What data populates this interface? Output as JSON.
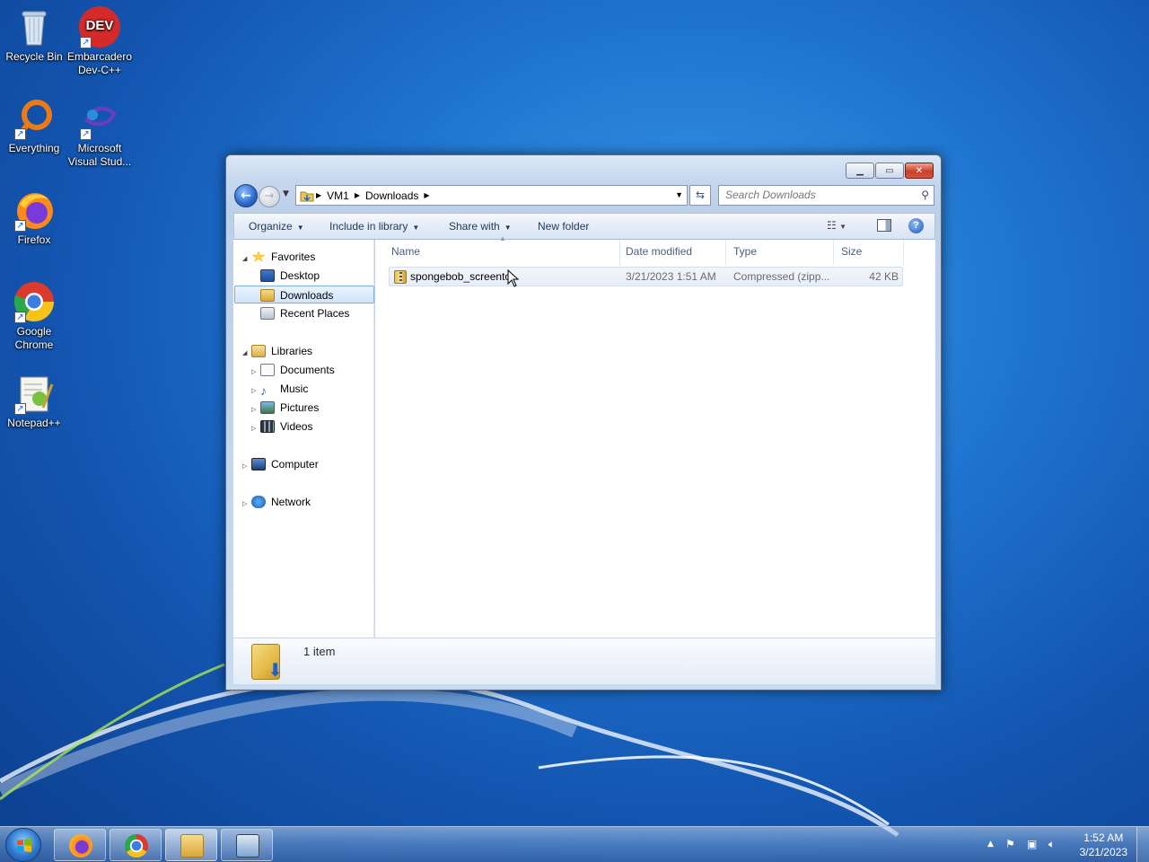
{
  "desktop": {
    "icons": [
      {
        "label": "Recycle Bin"
      },
      {
        "label": "Embarcadero Dev-C++"
      },
      {
        "label": "Everything"
      },
      {
        "label": "Microsoft Visual Stud..."
      },
      {
        "label": "Firefox"
      },
      {
        "label": "Google Chrome"
      },
      {
        "label": "Notepad++"
      }
    ],
    "devcpp_logo_text": "DEV"
  },
  "window": {
    "address": {
      "crumbs": [
        "VM1",
        "Downloads"
      ]
    },
    "search": {
      "placeholder": "Search Downloads"
    },
    "toolbar": {
      "organize": "Organize",
      "include_in_library": "Include in library",
      "share_with": "Share with",
      "new_folder": "New folder",
      "help": "?"
    },
    "nav_tree": {
      "favorites": "Favorites",
      "desktop": "Desktop",
      "downloads": "Downloads",
      "recent_places": "Recent Places",
      "libraries": "Libraries",
      "documents": "Documents",
      "music": "Music",
      "pictures": "Pictures",
      "videos": "Videos",
      "computer": "Computer",
      "network": "Network"
    },
    "columns": [
      "Name",
      "Date modified",
      "Type",
      "Size"
    ],
    "files": [
      {
        "name": "spongebob_screentc",
        "date": "3/21/2023 1:51 AM",
        "type": "Compressed (zipp...",
        "size": "42 KB"
      }
    ],
    "details": {
      "count": "1 item"
    }
  },
  "taskbar": {
    "clock_time": "1:52 AM",
    "clock_date": "3/21/2023"
  },
  "colors": {
    "accent": "#1f74cf",
    "selection": "#cfe4fb",
    "close_button": "#c8402a"
  }
}
